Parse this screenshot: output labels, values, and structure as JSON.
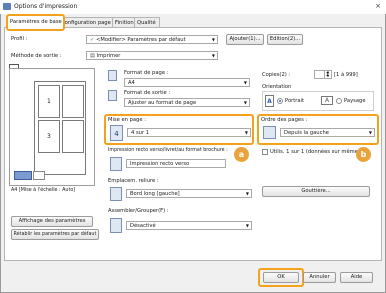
{
  "window": {
    "title": "Options d'impression"
  },
  "tabs": [
    {
      "label": "Paramètres de base"
    },
    {
      "label": "Configuration page"
    },
    {
      "label": "Finition"
    },
    {
      "label": "Qualité"
    }
  ],
  "profile": {
    "label": "Profil :",
    "value": "<Modifier> Paramètres par défaut",
    "add": "Ajouter(1)...",
    "edit": "Edition(2)..."
  },
  "output": {
    "label": "Méthode de sortie :",
    "value": "Imprimer"
  },
  "page_size": {
    "label": "Format de page :",
    "value": "A4"
  },
  "output_size": {
    "label": "Format de sortie :",
    "value": "Ajuster au format de page"
  },
  "layout": {
    "label": "Mise en page :",
    "value": "4 sur 1",
    "icon_digit": "4"
  },
  "duplex": {
    "label": "Impression recto verso/livret/au format brochure :",
    "value": "Impression recto verso"
  },
  "binding": {
    "label": "Emplacem. reliure :",
    "value": "Bord long [gauche]"
  },
  "finishing": {
    "label": "Assembler/Grouper(F) :",
    "value": "Désactivé"
  },
  "copies": {
    "label": "Copies(2) :",
    "value": "1",
    "range": "[1 à 999]"
  },
  "orientation": {
    "label": "Orientation",
    "portrait": "Portrait",
    "landscape": "Paysage",
    "portrait_letter": "A",
    "landscape_letter": "A"
  },
  "page_order": {
    "label": "Ordre des pages :",
    "value": "Depuis la gauche"
  },
  "one_sided": {
    "label": "Utilis. 1 sur 1 (données sur même pag"
  },
  "gutter": {
    "label": "Gouttière..."
  },
  "preview": {
    "page1": "1",
    "page3": "3",
    "caption": "A4 [Mise à l'échelle : Auto]"
  },
  "left_buttons": {
    "show": "Affichage des paramètres",
    "reset": "Rétablir les paramètres par défaut"
  },
  "badges": {
    "a": "a",
    "b": "b"
  },
  "footer": {
    "ok": "OK",
    "cancel": "Annuler",
    "help": "Aide"
  },
  "colors": {
    "highlight": "#f3a21b",
    "badge": "#e8a33d"
  }
}
